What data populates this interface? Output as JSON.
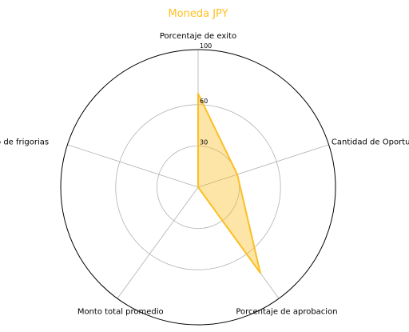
{
  "chart_data": {
    "type": "radar",
    "title": "Moneda JPY",
    "axes": [
      "Porcentaje de exito",
      "Cantidad de Oportunidades",
      "Porcentaje de aprobacion",
      "Monto total promedio",
      "Promedio de frigorias"
    ],
    "series": [
      {
        "values": [
          68,
          30,
          77,
          0,
          0
        ]
      }
    ],
    "rlim": [
      0,
      100
    ],
    "ticks": [
      {
        "value": 30,
        "label": "30"
      },
      {
        "value": 60,
        "label": "60"
      },
      {
        "value": 100,
        "label": "100"
      }
    ],
    "grid": true,
    "legend": false
  },
  "colors": {
    "title": "#ffbf1f",
    "series_line": "#fbbf24",
    "series_fill": "#fbbf24",
    "grid": "#b0b0b0",
    "outer_ring": "#000000"
  }
}
